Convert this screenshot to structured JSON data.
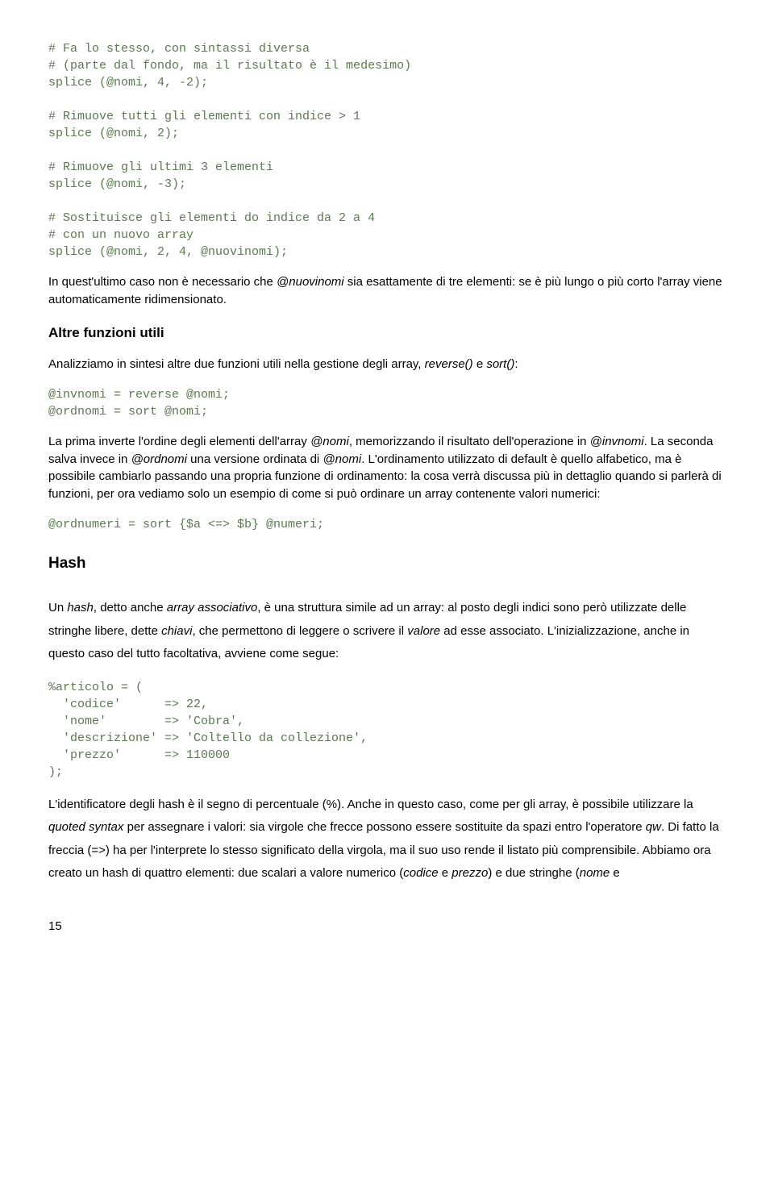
{
  "code1": "# Fa lo stesso, con sintassi diversa\n# (parte dal fondo, ma il risultato è il medesimo)\nsplice (@nomi, 4, -2);\n\n# Rimuove tutti gli elementi con indice > 1\nsplice (@nomi, 2);\n\n# Rimuove gli ultimi 3 elementi\nsplice (@nomi, -3);\n\n# Sostituisce gli elementi do indice da 2 a 4\n# con un nuovo array\nsplice (@nomi, 2, 4, @nuovinomi);",
  "para1_a": "In quest'ultimo caso non è necessario che ",
  "para1_i1": "@nuovinomi",
  "para1_b": " sia esattamente di tre elementi: se è più lungo o più corto l'array viene automaticamente ridimensionato.",
  "heading1": "Altre funzioni utili",
  "para2_a": "Analizziamo in sintesi altre due funzioni utili nella gestione degli array, ",
  "para2_i1": "reverse()",
  "para2_b": " e ",
  "para2_i2": "sort()",
  "para2_c": ":",
  "code2": "@invnomi = reverse @nomi;\n@ordnomi = sort @nomi;",
  "para3_a": "La prima inverte l'ordine degli elementi dell'array ",
  "para3_i1": "@nomi",
  "para3_b": ", memorizzando il risultato dell'operazione in ",
  "para3_i2": "@invnomi",
  "para3_c": ". La seconda salva invece in ",
  "para3_i3": "@ordnomi",
  "para3_d": " una versione ordinata di ",
  "para3_i4": "@nomi",
  "para3_e": ".",
  "para3_f": "L'ordinamento utilizzato di default è quello alfabetico, ma è possibile cambiarlo passando una propria funzione di ordinamento: la cosa verrà discussa più in dettaglio quando si parlerà di funzioni, per ora vediamo solo un esempio di come si può ordinare un array contenente valori numerici:",
  "code3": "@ordnumeri = sort {$a <=> $b} @numeri;",
  "heading2": "Hash",
  "para4_a": "Un ",
  "para4_i1": "hash",
  "para4_b": ", detto anche ",
  "para4_i2": "array associativo",
  "para4_c": ", è una struttura simile ad un array: al posto degli indici sono però utilizzate delle stringhe libere, dette ",
  "para4_i3": "chiavi",
  "para4_d": ", che permettono di leggere o scrivere il ",
  "para4_i4": "valore",
  "para4_e": " ad esse associato. L'inizializzazione, anche in questo caso del tutto facoltativa, avviene come segue:",
  "code4": "%articolo = (\n  'codice'      => 22,\n  'nome'        => 'Cobra',\n  'descrizione' => 'Coltello da collezione',\n  'prezzo'      => 110000\n);",
  "para5_a": "L'identificatore degli hash è il segno di percentuale (%). Anche in questo caso, come per gli array, è possibile utilizzare la ",
  "para5_i1": "quoted syntax",
  "para5_b": " per assegnare i valori: sia virgole che frecce possono essere sostituite da spazi entro l'operatore ",
  "para5_i2": "qw",
  "para5_c": ". Di fatto la freccia (=>) ha per l'interprete lo stesso significato della virgola, ma il suo uso rende il listato più comprensibile. Abbiamo ora creato un hash di quattro elementi: due scalari a valore numerico (",
  "para5_i3": "codice",
  "para5_d": " e ",
  "para5_i4": "prezzo",
  "para5_e": ") e due stringhe (",
  "para5_i5": "nome",
  "para5_f": " e",
  "pagenum": "15"
}
